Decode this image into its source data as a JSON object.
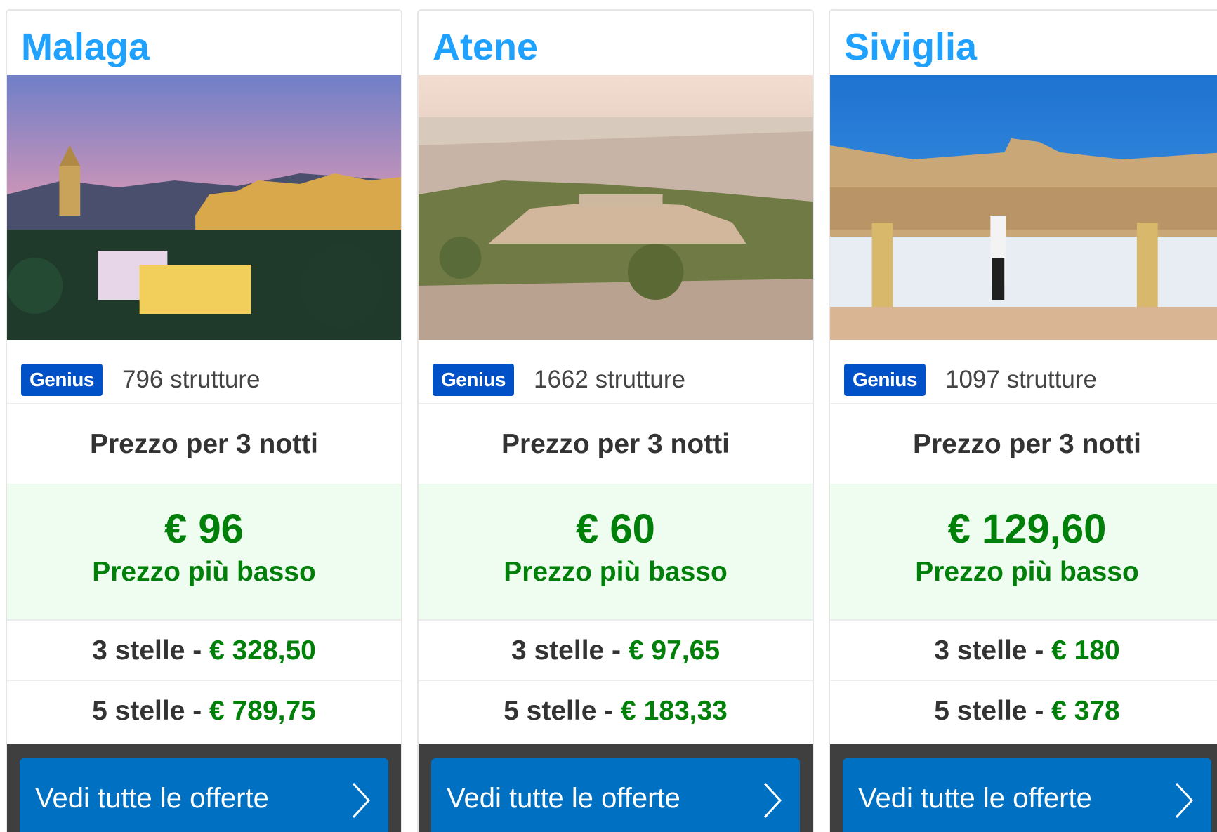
{
  "cards": [
    {
      "city": "Malaga",
      "badge": "Genius",
      "properties": "796 strutture",
      "nights_label": "Prezzo per 3 notti",
      "lowest_price": "€ 96",
      "lowest_label": "Prezzo più basso",
      "three_star_label": "3 stelle - ",
      "three_star_price": "€ 328,50",
      "five_star_label": "5 stelle - ",
      "five_star_price": "€ 789,75",
      "cta_label": "Vedi tutte le offerte"
    },
    {
      "city": "Atene",
      "badge": "Genius",
      "properties": "1662 strutture",
      "nights_label": "Prezzo per 3 notti",
      "lowest_price": "€ 60",
      "lowest_label": "Prezzo più basso",
      "three_star_label": "3 stelle - ",
      "three_star_price": "€ 97,65",
      "five_star_label": "5 stelle - ",
      "five_star_price": "€ 183,33",
      "cta_label": "Vedi tutte le offerte"
    },
    {
      "city": "Siviglia",
      "badge": "Genius",
      "properties": "1097 strutture",
      "nights_label": "Prezzo per 3 notti",
      "lowest_price": "€ 129,60",
      "lowest_label": "Prezzo più basso",
      "three_star_label": "3 stelle - ",
      "three_star_price": "€ 180",
      "five_star_label": "5 stelle - ",
      "five_star_price": "€ 378",
      "cta_label": "Vedi tutte le offerte"
    }
  ],
  "colors": {
    "title_blue": "#1fa1ff",
    "genius_blue": "#0050c8",
    "price_green": "#008009",
    "cta_blue": "#0071c2"
  },
  "icons": {
    "cta_chevron": "chevron-right-icon"
  }
}
